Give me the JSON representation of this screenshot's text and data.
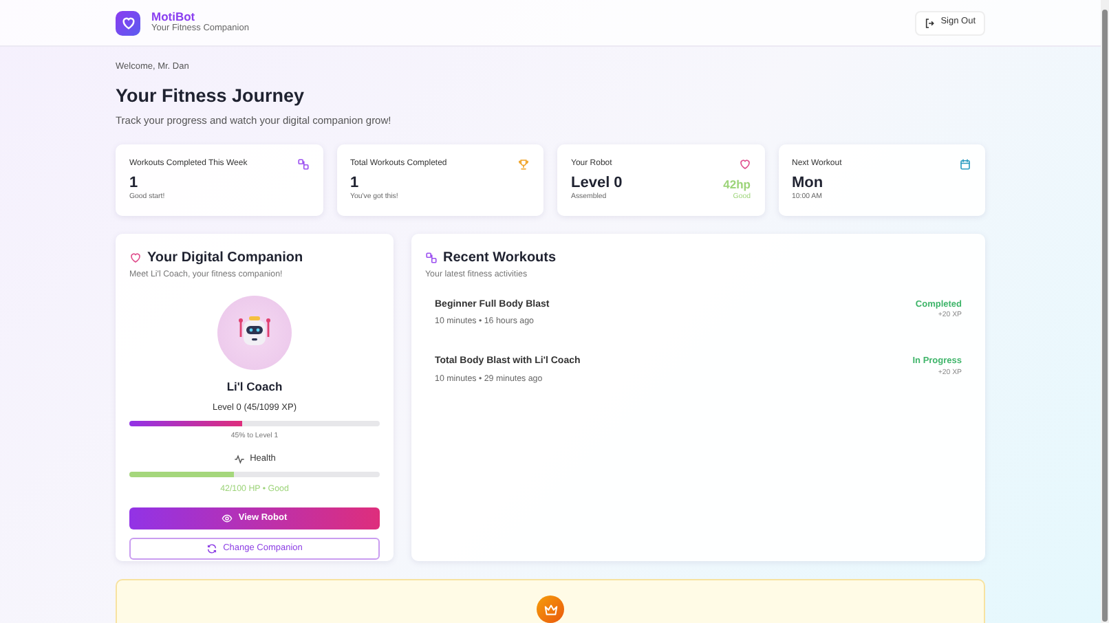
{
  "header": {
    "app_name": "MotiBot",
    "tagline": "Your Fitness Companion",
    "sign_out": "Sign Out"
  },
  "welcome": "Welcome, Mr. Dan",
  "title": "Your Fitness Journey",
  "subtitle": "Track your progress and watch your digital companion grow!",
  "stats": [
    {
      "label": "Workouts Completed This Week",
      "value": "1",
      "note": "Good start!",
      "kind": "weekly"
    },
    {
      "label": "Total Workouts Completed",
      "value": "1",
      "note": "You've got this!",
      "kind": "total"
    },
    {
      "label": "Your Robot",
      "value": "Level 0",
      "note": "Assembled",
      "kind": "robot",
      "side_value": "42hp",
      "side_note": "Good"
    },
    {
      "label": "Next Workout",
      "value": "Mon",
      "note": "10:00 AM",
      "kind": "schedule"
    }
  ],
  "companion": {
    "title": "Your Digital Companion",
    "subtitle": "Meet Li'l Coach, your fitness companion!",
    "name": "Li'l Coach",
    "level_text": "Level 0 (45/1099 XP)",
    "xp": {
      "level": 0.45
    },
    "xp_note": "45% to Level 1",
    "health_label": "Health",
    "health": {
      "level": 0.42
    },
    "health_note": "42/100 HP • Good",
    "view_button": "View Robot",
    "change_button": "Change Companion"
  },
  "recent": {
    "title": "Recent Workouts",
    "subtitle": "Your latest fitness activities",
    "workouts": [
      {
        "name": "Beginner Full Body Blast",
        "meta": "10 minutes • 16 hours ago",
        "status": "Completed",
        "xp": "+20 XP"
      },
      {
        "name": "Total Body Blast with Li'l Coach",
        "meta": "10 minutes • 29 minutes ago",
        "status": "In Progress",
        "xp": "+20 XP"
      }
    ]
  }
}
